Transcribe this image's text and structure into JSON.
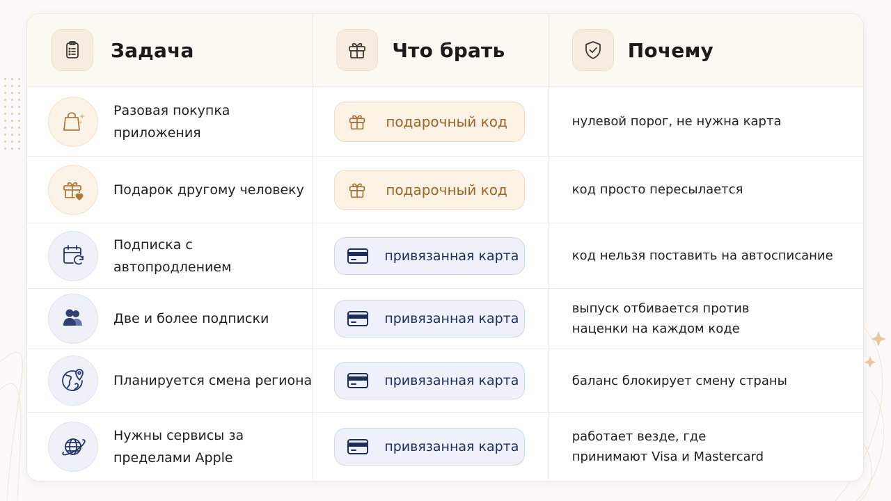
{
  "headers": {
    "task": "Задача",
    "what": "Что брать",
    "why": "Почему"
  },
  "icons": {
    "task": "clipboard-icon",
    "what": "gift-icon",
    "why": "shield-check-icon"
  },
  "colors": {
    "gift_accent": "#a87136",
    "card_accent": "#1c2d5c"
  },
  "rows": [
    {
      "icon": "shopping-bag-icon",
      "task": "Разовая покупка приложения",
      "pick": "подарочный код",
      "pick_type": "gift",
      "why": "нулевой порог, не нужна карта"
    },
    {
      "icon": "gift-heart-icon",
      "task": "Подарок другому человеку",
      "pick": "подарочный код",
      "pick_type": "gift",
      "why": "код просто пересылается"
    },
    {
      "icon": "calendar-refresh-icon",
      "task": "Подписка с автопродлением",
      "pick": "привязанная карта",
      "pick_type": "card",
      "why": "код нельзя поставить на автосписание"
    },
    {
      "icon": "users-icon",
      "task": "Две и более подписки",
      "pick": "привязанная карта",
      "pick_type": "card",
      "why": "выпуск отбивается против наценки на каждом коде"
    },
    {
      "icon": "globe-pin-icon",
      "task": "Планируется смена региона",
      "pick": "привязанная карта",
      "pick_type": "card",
      "why": "баланс блокирует смену страны"
    },
    {
      "icon": "globe-orbit-icon",
      "task": "Нужны сервисы за пределами Apple",
      "pick": "привязанная карта",
      "pick_type": "card",
      "why": "работает везде, где принимают Visa и Mastercard"
    }
  ]
}
